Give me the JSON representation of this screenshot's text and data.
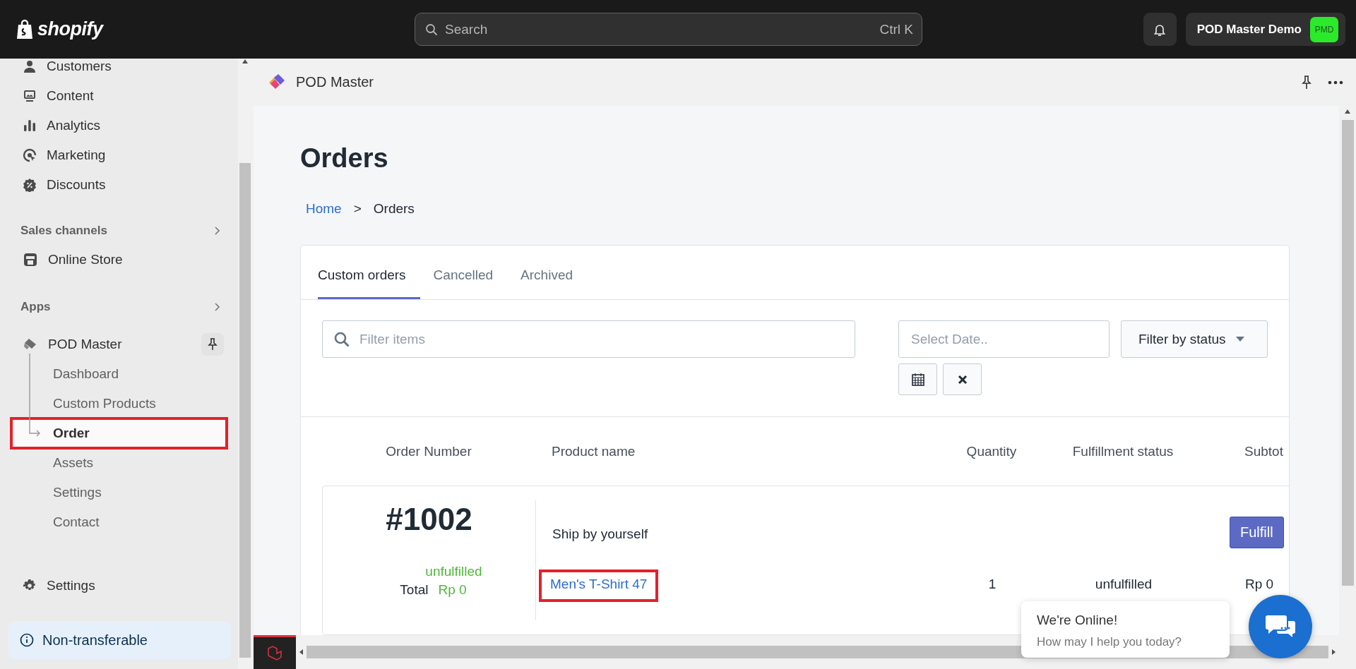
{
  "topbar": {
    "logo": "shopify",
    "search_placeholder": "Search",
    "shortcut": "Ctrl K",
    "store_name": "POD Master Demo",
    "store_initials": "PMD"
  },
  "sidebar": {
    "nav": [
      {
        "label": "Customers"
      },
      {
        "label": "Content"
      },
      {
        "label": "Analytics"
      },
      {
        "label": "Marketing"
      },
      {
        "label": "Discounts"
      }
    ],
    "sales_channels": {
      "heading": "Sales channels",
      "items": [
        {
          "label": "Online Store"
        }
      ]
    },
    "apps": {
      "heading": "Apps",
      "app": {
        "label": "POD Master",
        "children": [
          {
            "label": "Dashboard",
            "selected": false,
            "highlighted": false
          },
          {
            "label": "Custom Products",
            "selected": false,
            "highlighted": false
          },
          {
            "label": "Order",
            "selected": true,
            "highlighted": true
          },
          {
            "label": "Assets",
            "selected": false,
            "highlighted": false
          },
          {
            "label": "Settings",
            "selected": false,
            "highlighted": false
          },
          {
            "label": "Contact",
            "selected": false,
            "highlighted": false
          }
        ]
      }
    },
    "settings": "Settings",
    "notice": "Non-transferable"
  },
  "app_header": {
    "title": "POD Master"
  },
  "page": {
    "title": "Orders",
    "breadcrumb": [
      {
        "label": "Home",
        "kind": "link"
      },
      {
        "label": ">",
        "kind": "separator"
      },
      {
        "label": "Orders",
        "kind": "current"
      }
    ],
    "tabs": [
      {
        "label": "Custom orders",
        "selected": true
      },
      {
        "label": "Cancelled",
        "selected": false
      },
      {
        "label": "Archived",
        "selected": false
      }
    ],
    "filters": {
      "search_placeholder": "Filter items",
      "date_placeholder": "Select Date..",
      "status_label": "Filter by status"
    },
    "table": {
      "columns": [
        "Order Number",
        "Product name",
        "Quantity",
        "Fulfillment status",
        "Subtot"
      ],
      "orders": [
        {
          "number": "#1002",
          "status": "unfulfilled",
          "total_label": "Total",
          "total": "Rp 0",
          "shipping": "Ship by yourself",
          "action": "Fulfill",
          "items": [
            {
              "product": "Men's T-Shirt 47",
              "highlighted": true,
              "quantity": "1",
              "fulfillment": "unfulfilled",
              "subtotal": "Rp 0"
            }
          ]
        }
      ]
    }
  },
  "chat": {
    "title": "We're Online!",
    "subtitle": "How may I help you today?"
  }
}
